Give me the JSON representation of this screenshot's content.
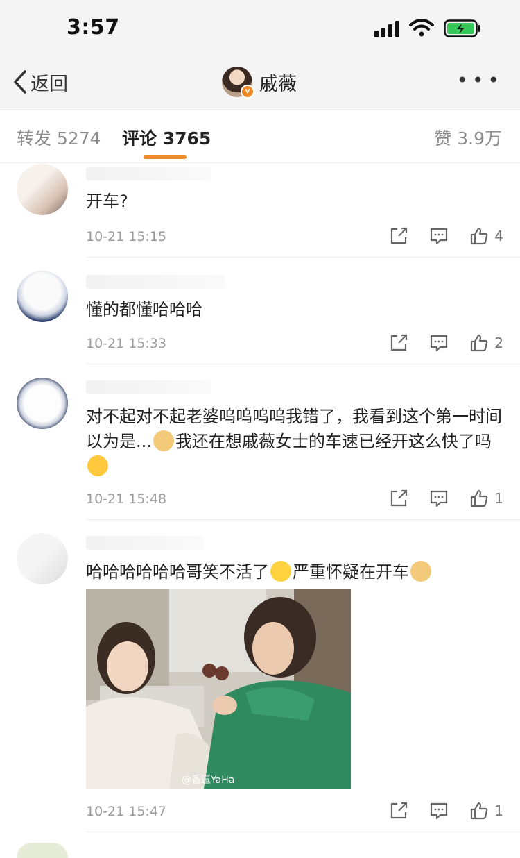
{
  "status_bar": {
    "time": "3:57"
  },
  "nav": {
    "back_label": "返回",
    "title": "戚薇"
  },
  "tabs": {
    "repost": "转发 5274",
    "comments": "评论 3765",
    "likes": "赞 3.9万"
  },
  "comments": [
    {
      "text": "开车?",
      "time": "10-21 15:15",
      "likes": "4"
    },
    {
      "text": "懂的都懂哈哈哈",
      "time": "10-21 15:33",
      "likes": "2"
    },
    {
      "text_a": "对不起对不起老婆呜呜呜呜我错了，我看到这个第一时间以为是...",
      "text_b": "我还在想戚薇女士的车速已经开这么快了吗",
      "time": "10-21 15:48",
      "likes": "1"
    },
    {
      "text_a": "哈哈哈哈哈哈哥笑不活了",
      "text_b": "严重怀疑在开车",
      "watermark": "@香逗YaHa",
      "time": "10-21 15:47",
      "likes": "1"
    }
  ],
  "colors": {
    "accent": "#f08a24",
    "verified": "#f08a24",
    "battery": "#34c759"
  },
  "icons": [
    "back-chevron-icon",
    "signal-icon",
    "wifi-icon",
    "battery-icon",
    "more-icon",
    "share-icon",
    "comment-icon",
    "like-icon",
    "doge-emoji",
    "cry-emoji",
    "laugh-emoji"
  ]
}
